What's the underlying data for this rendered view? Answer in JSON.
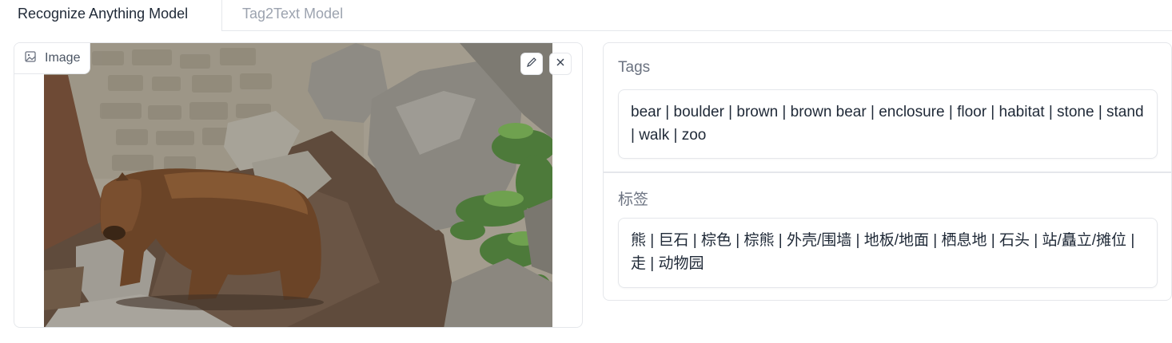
{
  "tabs": [
    {
      "label": "Recognize Anything Model",
      "active": true
    },
    {
      "label": "Tag2Text Model",
      "active": false
    }
  ],
  "image_input": {
    "label": "Image"
  },
  "output": {
    "tags_label": "Tags",
    "tags_value": "bear | boulder | brown | brown bear | enclosure | floor | habitat | stone | stand | walk | zoo",
    "zh_label": "标签",
    "zh_value": "熊 | 巨石 | 棕色 | 棕熊 | 外壳/围墙 | 地板/地面 | 栖息地 | 石头 | 站/矗立/摊位 | 走 | 动物园"
  }
}
